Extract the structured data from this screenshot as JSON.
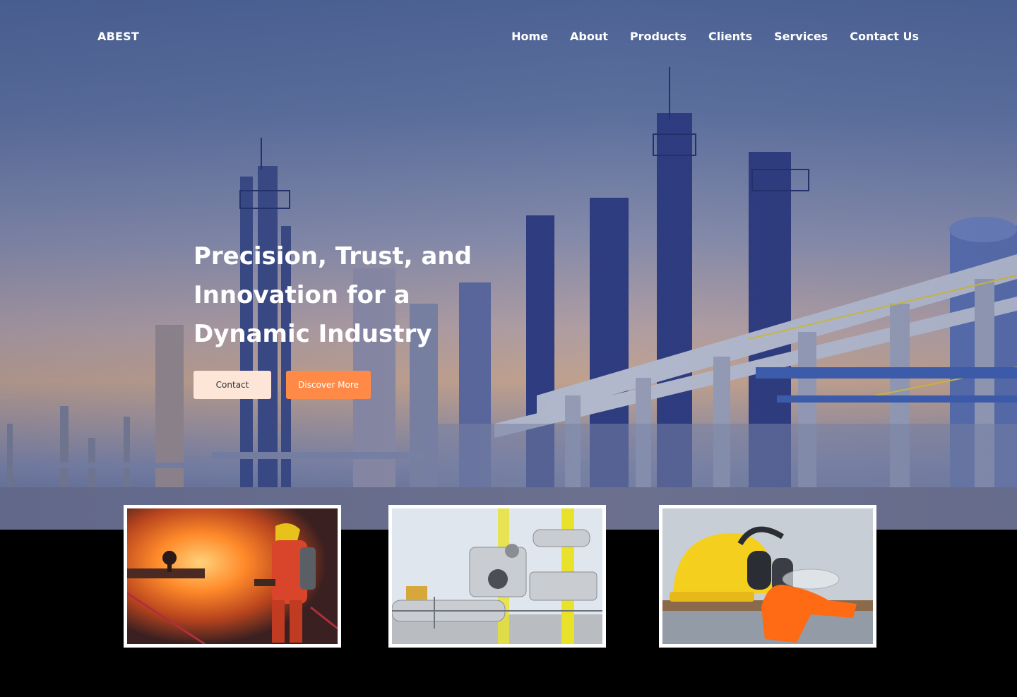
{
  "brand": {
    "name": "ABEST"
  },
  "nav": {
    "items": [
      "Home",
      "About",
      "Products",
      "Clients",
      "Services",
      "Contact Us"
    ]
  },
  "hero": {
    "headline": "Precision, Trust, and Innovation for a Dynamic Industry",
    "buttons": {
      "contact": "Contact",
      "discover": "Discover More"
    },
    "colors": {
      "accent": "#ff8a47",
      "contact_bg": "#fde5d8"
    }
  },
  "cards": [
    {
      "image": "firefighter-photo"
    },
    {
      "image": "pipeline-valves-photo"
    },
    {
      "image": "safety-gear-photo"
    }
  ]
}
